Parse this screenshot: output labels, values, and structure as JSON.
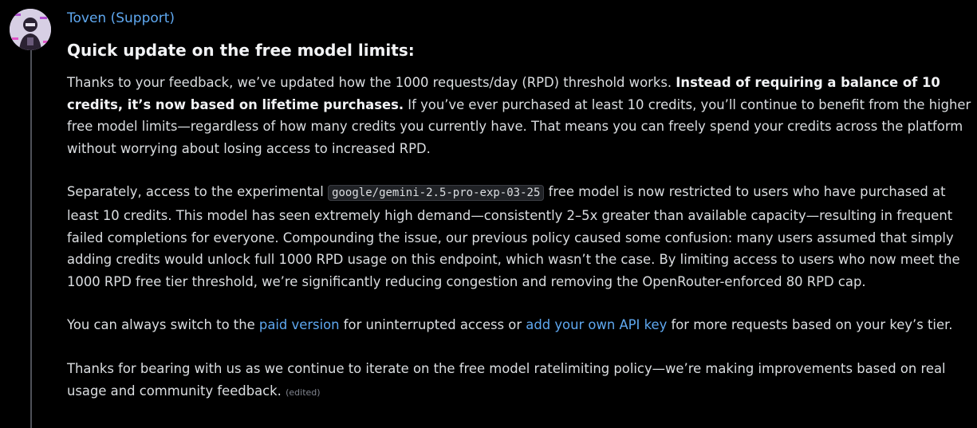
{
  "message": {
    "author": "Toven (Support)",
    "heading": "Quick update on the free model limits:",
    "p1": {
      "t1": "Thanks to your feedback, we’ve updated how the 1000 requests/day (RPD) threshold works. ",
      "bold": "Instead of requiring a balance of 10 credits, it’s now based on lifetime purchases.",
      "t2": " If you’ve ever purchased at least 10 credits, you’ll continue to benefit from the higher free model limits—regardless of how many credits you currently have. That means you can freely spend your credits across the platform without worrying about losing access to increased RPD."
    },
    "p2": {
      "t1": "Separately, access to the experimental ",
      "code": "google/gemini-2.5-pro-exp-03-25",
      "t2": " free model is now restricted to users who have purchased at least 10 credits. This model has seen extremely high demand—consistently 2–5x greater than available capacity—resulting in frequent failed completions for everyone. Compounding the issue, our previous policy caused some confusion: many users assumed that simply adding credits would unlock full 1000 RPD usage on this endpoint, which wasn’t the case. By limiting access to users who now meet the 1000 RPD free tier threshold, we’re significantly reducing congestion and removing the OpenRouter-enforced 80 RPD cap."
    },
    "p3": {
      "t1": "You can always switch to the ",
      "link1": "paid version",
      "t2": " for uninterrupted access or ",
      "link2": "add your own API key",
      "t3": " for more requests based on your key’s tier."
    },
    "p4": {
      "t1": "Thanks for bearing with us as we continue to iterate on the free model ratelimiting policy—we’re making improvements based on real usage and community feedback.",
      "edited": "(edited)"
    }
  },
  "colors": {
    "background": "#000000",
    "text": "#dbdee1",
    "link": "#5fa8f0",
    "heading": "#f2f3f5"
  }
}
